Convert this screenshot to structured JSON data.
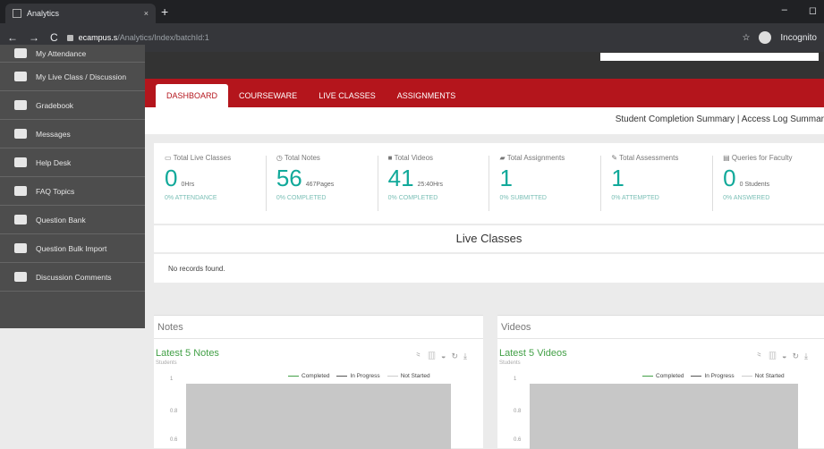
{
  "browser": {
    "tab_title": "Analytics",
    "tab_close": "×",
    "new_tab": "+",
    "url_host": "ecampus.s",
    "url_path": "/Analytics/Index/batchId:1",
    "incognito": "Incognito",
    "star": "☆",
    "min": "–",
    "max": "◻"
  },
  "sidebar": {
    "items": [
      {
        "label": "My Attendance",
        "icon": "user-icon"
      },
      {
        "label": "My Live Class / Discussion",
        "icon": "user-icon"
      },
      {
        "label": "Gradebook",
        "icon": "graduation-cap-icon"
      },
      {
        "label": "Messages",
        "icon": "envelope-icon"
      },
      {
        "label": "Help Desk",
        "icon": "user-icon"
      },
      {
        "label": "FAQ Topics",
        "icon": "user-icon"
      },
      {
        "label": "Question Bank",
        "icon": "question-icon"
      },
      {
        "label": "Question Bulk Import",
        "icon": "cloud-upload-icon"
      },
      {
        "label": "Discussion Comments",
        "icon": "database-icon"
      }
    ]
  },
  "tabs": [
    "DASHBOARD",
    "COURSEWARE",
    "LIVE CLASSES",
    "ASSIGNMENTS"
  ],
  "summary_links": "Student Completion Summary | Access Log Summar",
  "stats": [
    {
      "label": "Total Live Classes",
      "value": "0",
      "sub": "0Hrs",
      "foot": "0% ATTENDANCE"
    },
    {
      "label": "Total Notes",
      "value": "56",
      "sub": "467Pages",
      "foot": "0% COMPLETED"
    },
    {
      "label": "Total Videos",
      "value": "41",
      "sub": "25:40Hrs",
      "foot": "0% COMPLETED"
    },
    {
      "label": "Total Assignments",
      "value": "1",
      "sub": "",
      "foot": "0% SUBMITTED"
    },
    {
      "label": "Total Assessments",
      "value": "1",
      "sub": "",
      "foot": "0% ATTEMPTED"
    },
    {
      "label": "Queries for Faculty",
      "value": "0",
      "sub": "0 Students",
      "foot": "0% ANSWERED"
    }
  ],
  "live_classes": {
    "title": "Live Classes",
    "empty": "No records found."
  },
  "notes": {
    "header": "Notes",
    "chart_title": "Latest 5 Notes",
    "ylabel": "Students",
    "legend": [
      "Completed",
      "In Progress",
      "Not Started"
    ],
    "yticks": [
      "1",
      "0.8",
      "0.6"
    ]
  },
  "videos": {
    "header": "Videos",
    "chart_title": "Latest 5 Videos",
    "ylabel": "Students",
    "legend": [
      "Completed",
      "In Progress",
      "Not Started"
    ],
    "yticks": [
      "1",
      "0.8",
      "0.6"
    ]
  },
  "colors": {
    "brand_red": "#b4151c",
    "accent_teal": "#11a99a",
    "chart_green": "#43a047"
  }
}
